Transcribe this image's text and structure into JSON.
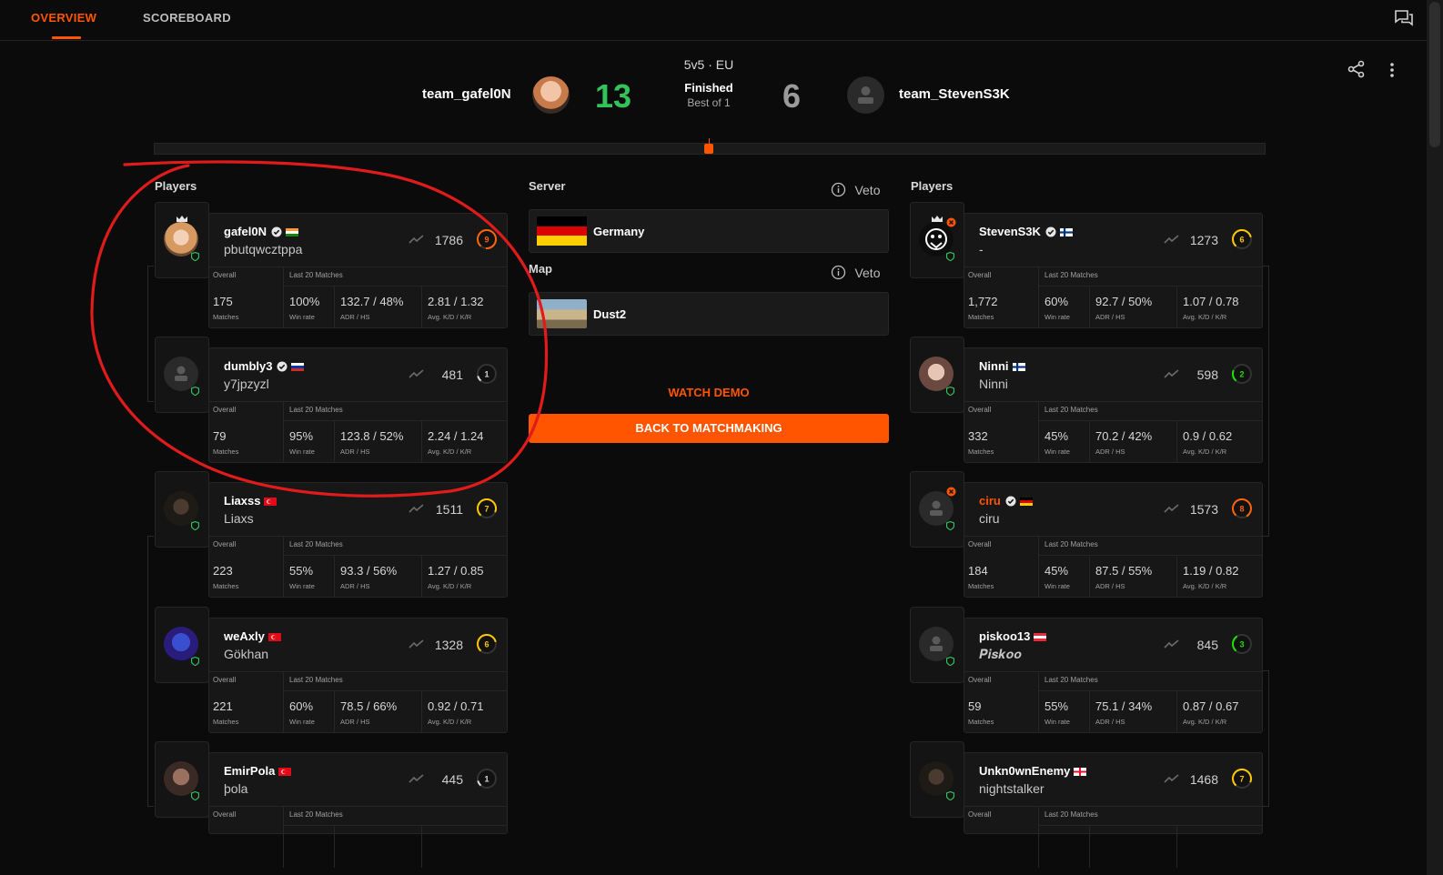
{
  "tabs": [
    {
      "label": "OVERVIEW",
      "active": true
    },
    {
      "label": "SCOREBOARD",
      "active": false
    }
  ],
  "match": {
    "mode": "5v5 · EU",
    "status": "Finished",
    "format": "Best of 1",
    "team1": {
      "name": "team_gafel0N",
      "score": "13"
    },
    "team2": {
      "name": "team_StevenS3K",
      "score": "6"
    }
  },
  "colors": {
    "accent": "#ff5500",
    "win": "#32c35a",
    "lose": "#9a9a9a"
  },
  "server": {
    "title": "Server",
    "veto": "Veto",
    "name": "Germany"
  },
  "map": {
    "title": "Map",
    "veto": "Veto",
    "name": "Dust2"
  },
  "actions": {
    "watch_demo": "WATCH DEMO",
    "back": "BACK TO MATCHMAKING"
  },
  "labels": {
    "players": "Players",
    "overall": "Overall",
    "last20": "Last 20 Matches",
    "matches": "Matches",
    "winrate": "Win rate",
    "adr": "ADR / HS",
    "kd": "Avg. K/D / K/R"
  },
  "team1_players": [
    {
      "name": "gafel0N",
      "sub": "pbutqwcztppa",
      "elo": "1786",
      "level": "9",
      "matches": "175",
      "winrate": "100%",
      "adr": "132.7 / 48%",
      "kd": "2.81 / 1.32",
      "verified": true,
      "flag": "in",
      "captain": true,
      "avatar": "anime"
    },
    {
      "name": "dumbly3",
      "sub": "y7jpzyzl",
      "elo": "481",
      "level": "1",
      "matches": "79",
      "winrate": "95%",
      "adr": "123.8 / 52%",
      "kd": "2.24 / 1.24",
      "verified": true,
      "flag": "ru",
      "captain": false,
      "avatar": "default"
    },
    {
      "name": "Liaxss",
      "sub": "Liaxs",
      "elo": "1511",
      "level": "7",
      "matches": "223",
      "winrate": "55%",
      "adr": "93.3 / 56%",
      "kd": "1.27 / 0.85",
      "verified": false,
      "flag": "tr",
      "captain": false,
      "avatar": "dark"
    },
    {
      "name": "weAxly",
      "sub": "Gökhan",
      "elo": "1328",
      "level": "6",
      "matches": "221",
      "winrate": "60%",
      "adr": "78.5 / 66%",
      "kd": "0.92 / 0.71",
      "verified": false,
      "flag": "tr",
      "captain": false,
      "avatar": "blue"
    },
    {
      "name": "EmirPola",
      "sub": "þola",
      "elo": "445",
      "level": "1",
      "matches": "",
      "winrate": "",
      "adr": "",
      "kd": "",
      "verified": false,
      "flag": "tr",
      "captain": false,
      "avatar": "face"
    }
  ],
  "team2_players": [
    {
      "name": "StevenS3K",
      "sub": "-",
      "elo": "1273",
      "level": "6",
      "matches": "1,772",
      "winrate": "60%",
      "adr": "92.7 / 50%",
      "kd": "1.07 / 0.78",
      "verified": true,
      "flag": "fi",
      "captain": true,
      "avatar": "logo"
    },
    {
      "name": "Ninni",
      "sub": "Ninni",
      "elo": "598",
      "level": "2",
      "matches": "332",
      "winrate": "45%",
      "adr": "70.2 / 42%",
      "kd": "0.9 / 0.62",
      "verified": false,
      "flag": "fi",
      "captain": false,
      "avatar": "girl"
    },
    {
      "name": "ciru",
      "sub": "ciru",
      "elo": "1573",
      "level": "8",
      "matches": "184",
      "winrate": "45%",
      "adr": "87.5 / 55%",
      "kd": "1.19 / 0.82",
      "verified": true,
      "flag": "de",
      "captain": false,
      "avatar": "default",
      "orange_name": true
    },
    {
      "name": "piskoo13",
      "sub": "𝑷𝒊𝒔𝒌𝒐𝒐",
      "elo": "845",
      "level": "3",
      "matches": "59",
      "winrate": "55%",
      "adr": "75.1 / 34%",
      "kd": "0.87 / 0.67",
      "verified": false,
      "flag": "at",
      "captain": false,
      "avatar": "default"
    },
    {
      "name": "Unkn0wnEnemy",
      "sub": "nightstalker",
      "elo": "1468",
      "level": "7",
      "matches": "",
      "winrate": "",
      "adr": "",
      "kd": "",
      "verified": false,
      "flag": "ge",
      "captain": false,
      "avatar": "dark"
    }
  ]
}
